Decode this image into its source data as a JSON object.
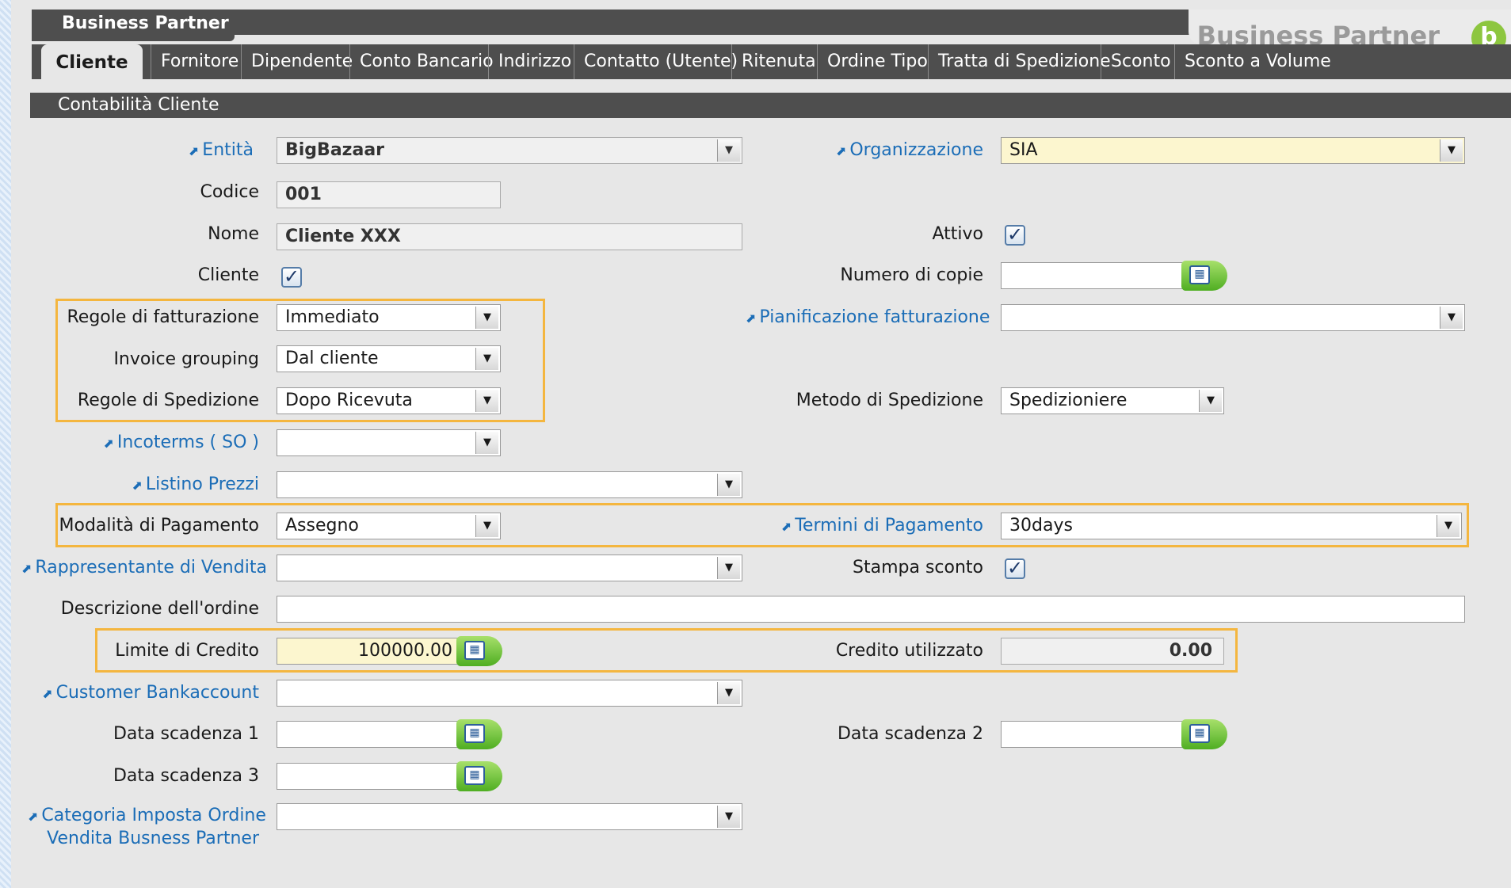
{
  "window": {
    "tab_title": "Business Partner",
    "brand_title": "Business Partner",
    "brand_logo_letter": "b"
  },
  "tabs": [
    "Cliente",
    "Fornitore",
    "Dipendente",
    "Conto Bancario",
    "Indirizzo",
    "Contatto (Utente)",
    "Ritenuta",
    "Ordine Tipo",
    "Tratta di Spedizione",
    "Sconto",
    "Sconto a Volume"
  ],
  "section": {
    "title": "Contabilità Cliente"
  },
  "icons": {
    "link_arrow": "⬈",
    "dropdown": "▼",
    "check": "✓",
    "calendar": "▦"
  },
  "form": {
    "entita": {
      "label": "Entità",
      "value": "BigBazaar"
    },
    "codice": {
      "label": "Codice",
      "value": "001"
    },
    "nome": {
      "label": "Nome",
      "value": "Cliente XXX"
    },
    "cliente": {
      "label": "Cliente",
      "checked": true
    },
    "regole_fatturazione": {
      "label": "Regole di fatturazione",
      "value": "Immediato"
    },
    "invoice_grouping": {
      "label": "Invoice grouping",
      "value": "Dal cliente"
    },
    "regole_spedizione": {
      "label": "Regole di Spedizione",
      "value": "Dopo Ricevuta"
    },
    "incoterms": {
      "label": "Incoterms ( SO )",
      "value": ""
    },
    "listino": {
      "label": "Listino Prezzi",
      "value": ""
    },
    "modalita_pagamento": {
      "label": "Modalità di Pagamento",
      "value": "Assegno"
    },
    "rappresentante": {
      "label": "Rappresentante di Vendita",
      "value": ""
    },
    "descrizione": {
      "label": "Descrizione dell'ordine",
      "value": ""
    },
    "limite_credito": {
      "label": "Limite di Credito",
      "value": "100000.00"
    },
    "customer_bank": {
      "label": "Customer Bankaccount",
      "value": ""
    },
    "data_scadenza_1": {
      "label": "Data scadenza 1",
      "value": ""
    },
    "data_scadenza_3": {
      "label": "Data scadenza 3",
      "value": ""
    },
    "categoria_imposta": {
      "label_line1": "Categoria Imposta Ordine",
      "label_line2": "Vendita Busness Partner",
      "value": ""
    },
    "organizzazione": {
      "label": "Organizzazione",
      "value": "SIA"
    },
    "attivo": {
      "label": "Attivo",
      "checked": true
    },
    "numero_copie": {
      "label": "Numero di copie",
      "value": ""
    },
    "pianificazione": {
      "label": "Pianificazione fatturazione",
      "value": ""
    },
    "metodo_spedizione": {
      "label": "Metodo di Spedizione",
      "value": "Spedizioniere"
    },
    "termini_pagamento": {
      "label": "Termini di Pagamento",
      "value": "30days"
    },
    "stampa_sconto": {
      "label": "Stampa sconto",
      "checked": true
    },
    "credito_utilizzato": {
      "label": "Credito utilizzato",
      "value": "0.00"
    },
    "data_scadenza_2": {
      "label": "Data scadenza 2",
      "value": ""
    }
  },
  "colors": {
    "header": "#4e4e4e",
    "link": "#1b6db7",
    "highlight": "#f4b63f",
    "mandatory": "#fcf6cf"
  }
}
